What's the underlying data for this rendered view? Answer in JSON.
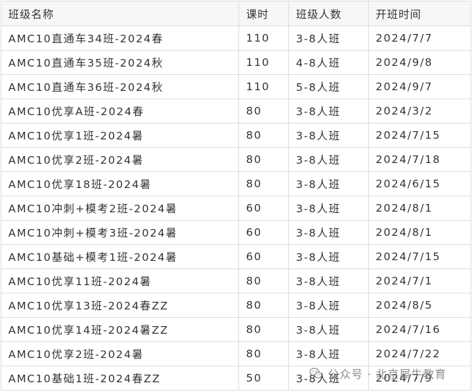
{
  "table": {
    "headers": [
      "班级名称",
      "课时",
      "班级人数",
      "开班时间"
    ],
    "rows": [
      [
        "AMC10直通车34班-2024春",
        "110",
        "3-8人班",
        "2024/7/7"
      ],
      [
        "AMC10直通车35班-2024秋",
        "110",
        "4-8人班",
        "2024/9/8"
      ],
      [
        "AMC10直通车36班-2024秋",
        "110",
        "5-8人班",
        "2024/9/7"
      ],
      [
        "AMC10优享A班-2024春",
        "80",
        "3-8人班",
        "2024/3/2"
      ],
      [
        "AMC10优享1班-2024暑",
        "80",
        "3-8人班",
        "2024/7/15"
      ],
      [
        "AMC10优享2班-2024暑",
        "80",
        "3-8人班",
        "2024/7/18"
      ],
      [
        "AMC10优享18班-2024暑",
        "80",
        "3-8人班",
        "2024/6/15"
      ],
      [
        "AMC10冲刺+模考2班-2024暑",
        "60",
        "3-8人班",
        "2024/8/1"
      ],
      [
        "AMC10冲刺+模考3班-2024暑",
        "60",
        "3-8人班",
        "2024/8/1"
      ],
      [
        "AMC10基础+模考1班-2024暑",
        "60",
        "3-8人班",
        "2024/7/15"
      ],
      [
        "AMC10优享11班-2024暑",
        "80",
        "3-8人班",
        "2024/7/1"
      ],
      [
        "AMC10优享13班-2024春ZZ",
        "80",
        "3-8人班",
        "2024/8/5"
      ],
      [
        "AMC10优享14班-2024暑ZZ",
        "80",
        "3-8人班",
        "2024/7/16"
      ],
      [
        "AMC10优享2班-2024暑",
        "80",
        "3-8人班",
        "2024/7/22"
      ],
      [
        "AMC10基础1班-2024春ZZ",
        "50",
        "3-8人班",
        "2024/7/9"
      ]
    ]
  },
  "watermark": {
    "text": "公众号 · 北京犀牛教育",
    "icon": "wechat-logo-icon"
  }
}
